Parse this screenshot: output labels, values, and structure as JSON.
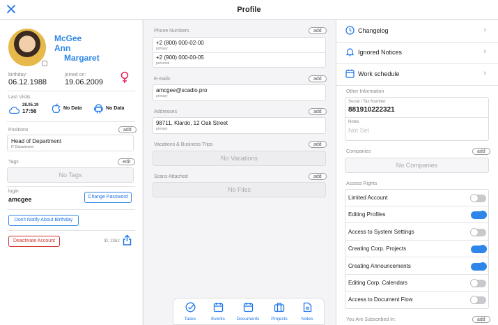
{
  "header": {
    "title": "Profile"
  },
  "profile": {
    "first_name": "McGee",
    "middle_name": "Ann",
    "last_name": "Margaret",
    "birthday_label": "birthday:",
    "birthday": "06.12.1988",
    "joined_label": "joined on:",
    "joined": "19.06.2009",
    "last_visits_label": "Last Visits",
    "visits": [
      {
        "icon": "cloud-icon",
        "date": "28.05.19",
        "time": "17:56"
      },
      {
        "icon": "apple-icon",
        "text": "No Data"
      },
      {
        "icon": "android-icon",
        "text": "No Data"
      }
    ],
    "positions_label": "Positions",
    "positions_add": "add",
    "position_title": "Head of Department",
    "position_dept": "IT Department",
    "tags_label": "Tags",
    "tags_edit": "edit",
    "tags_empty": "No Tags",
    "login_label": "login",
    "login": "amcgee",
    "change_password": "Change Password",
    "dont_notify": "Don't Notify About Birthday",
    "deactivate": "Deactivate Account",
    "id": "ID: 2362"
  },
  "contacts": {
    "phones_label": "Phone Numbers",
    "phones_add": "add",
    "phones": [
      {
        "number": "+2 (800) 000-02-00",
        "type": "primary"
      },
      {
        "number": "+2 (900) 000-00-05",
        "type": "personal"
      }
    ],
    "emails_label": "E-mails",
    "emails_add": "add",
    "email": "amcgee@scadio.pro",
    "email_type": "primary",
    "addresses_label": "Addresses",
    "addresses_add": "add",
    "address": "98711, Klardo, 12 Oak Street",
    "address_type": "primary",
    "vacations_label": "Vacations & Business Trips",
    "vacations_add": "add",
    "vacations_empty": "No Vacations",
    "scans_label": "Scans Attached",
    "scans_add": "add",
    "scans_empty": "No Files"
  },
  "tabbar": {
    "tasks": "Tasks",
    "events": "Events",
    "documents": "Documents",
    "projects": "Projects",
    "notes": "Notes"
  },
  "side": {
    "changelog": "Changelog",
    "ignored": "Ignored Notices",
    "schedule": "Work schedule",
    "other_label": "Other Information",
    "tax_label": "Social / Tax Number",
    "tax": "881910222321",
    "notes_label": "Notes",
    "notes_value": "Not Set",
    "companies_label": "Companies",
    "companies_add": "add",
    "companies_empty": "No Companies",
    "access_label": "Access Rights",
    "rights": [
      {
        "label": "Limited Account",
        "on": false
      },
      {
        "label": "Editing Profiles",
        "on": true
      },
      {
        "label": "Access to System Settings",
        "on": false
      },
      {
        "label": "Creating Corp. Projects",
        "on": true
      },
      {
        "label": "Creating Announcements",
        "on": true
      },
      {
        "label": "Editing Corp. Calendars",
        "on": false
      },
      {
        "label": "Access to Document Flow",
        "on": false
      }
    ],
    "subscribed_label": "You Are Subscribed In:",
    "subscribed_add": "add"
  },
  "colors": {
    "accent": "#1a73e8",
    "toggle_on": "#2d86e8",
    "danger": "#d0312d",
    "female": "#e8245a"
  }
}
